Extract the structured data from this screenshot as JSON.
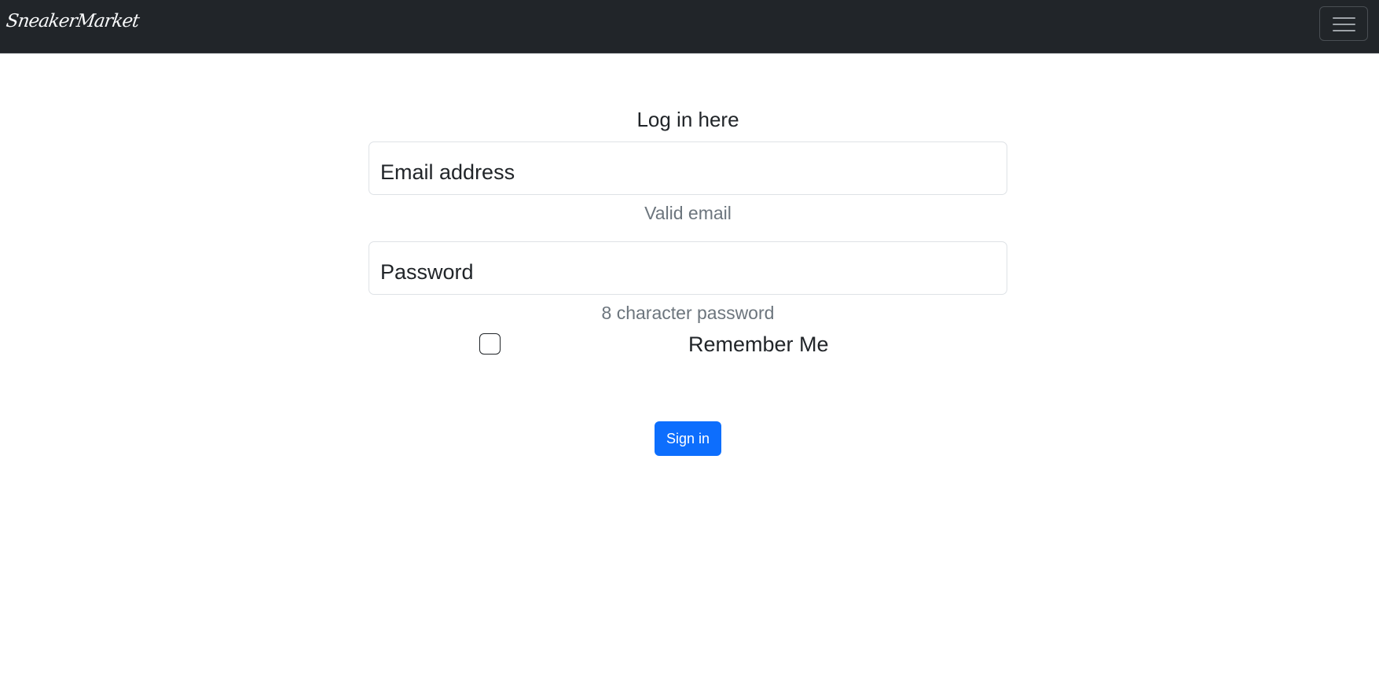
{
  "navbar": {
    "brand": "SneakerMarket",
    "toggler_icon": "hamburger-menu-icon",
    "background_color": "#212529"
  },
  "form": {
    "title": "Log in here",
    "email": {
      "placeholder": "Email address",
      "value": "",
      "hint": "Valid email"
    },
    "password": {
      "placeholder": "Password",
      "value": "",
      "hint": "8 character password"
    },
    "remember": {
      "label": "Remember Me",
      "checked": false
    },
    "submit_label": "Sign in",
    "submit_color": "#0d6efd"
  }
}
